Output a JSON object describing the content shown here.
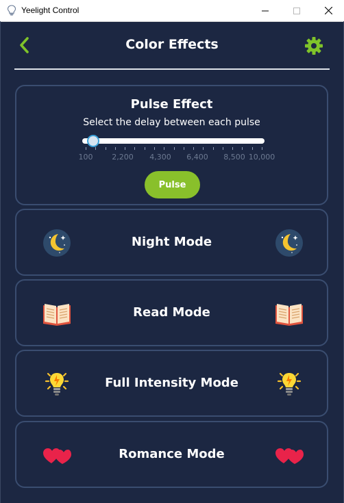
{
  "window": {
    "title": "Yeelight Control"
  },
  "header": {
    "title": "Color Effects"
  },
  "pulse": {
    "title": "Pulse Effect",
    "subtitle": "Select the delay between each pulse",
    "button_label": "Pulse",
    "slider": {
      "min": 100,
      "max": 10000,
      "value": 200
    },
    "tick_labels": [
      "100",
      "2,200",
      "4,300",
      "6,400",
      "8,500",
      "10,000"
    ]
  },
  "modes": [
    {
      "label": "Night Mode",
      "icon": "moon-icon"
    },
    {
      "label": "Read Mode",
      "icon": "book-icon"
    },
    {
      "label": "Full Intensity Mode",
      "icon": "light-bulb-icon"
    },
    {
      "label": "Romance Mode",
      "icon": "hearts-icon"
    }
  ],
  "colors": {
    "background": "#1c2742",
    "card_border": "#3a4d70",
    "accent_green": "#89c02b",
    "slider_thumb_border": "#3aa0d8"
  }
}
